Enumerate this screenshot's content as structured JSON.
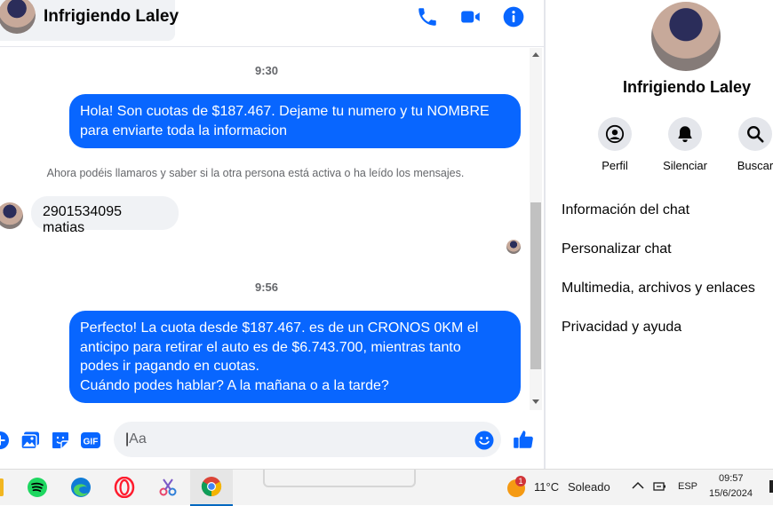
{
  "header": {
    "name": "Infrigiendo Laley"
  },
  "messages": {
    "time1": "9:30",
    "out1_line1": "Hola! Son cuotas de $187.467. Dejame tu numero y tu NOMBRE",
    "out1_line2": "para enviarte toda la informacion",
    "notice": "Ahora podéis llamaros y saber si la otra persona está activa o ha leído los mensajes.",
    "in1": "2901534095 matias",
    "time2": "9:56",
    "out2_line1": "Perfecto! La cuota desde $187.467. es de un CRONOS 0KM el",
    "out2_line2": "anticipo para retirar el auto es de $6.743.700, mientras tanto",
    "out2_line3": "podes ir pagando en cuotas.",
    "out2_line4": "Cuándo podes hablar? A la mañana o a la tarde?"
  },
  "composer": {
    "placeholder": "Aa"
  },
  "sidebar": {
    "name": "Infrigiendo Laley",
    "actions": {
      "profile": "Perfil",
      "mute": "Silenciar",
      "search": "Buscar"
    },
    "menu": {
      "chat_info": "Información del chat",
      "customize": "Personalizar chat",
      "media": "Multimedia, archivos y enlaces",
      "privacy": "Privacidad y ayuda"
    }
  },
  "taskbar": {
    "weather_temp": "11°C",
    "weather_desc": "Soleado",
    "badge": "1",
    "language": "ESP",
    "time": "09:57",
    "date": "15/6/2024"
  },
  "colors": {
    "accent": "#0866ff",
    "bubble_in": "#f0f2f5"
  }
}
